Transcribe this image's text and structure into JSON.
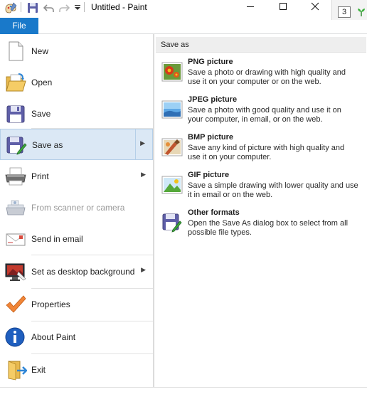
{
  "titlebar": {
    "title": "Untitled - Paint",
    "minimize_icon": "minimize-icon",
    "maximize_icon": "maximize-icon",
    "close_icon": "close-icon",
    "right_edge_value": "3"
  },
  "ribbon": {
    "file_tab": "File"
  },
  "menu": {
    "items": [
      {
        "label": "New",
        "icon": "new-document-icon"
      },
      {
        "label": "Open",
        "icon": "open-folder-icon"
      },
      {
        "label": "Save",
        "icon": "save-icon"
      },
      {
        "label": "Save as",
        "icon": "save-as-icon"
      },
      {
        "label": "Print",
        "icon": "printer-icon"
      },
      {
        "label": "From scanner or camera",
        "icon": "scanner-icon"
      },
      {
        "label": "Send in email",
        "icon": "email-icon"
      },
      {
        "label": "Set as desktop background",
        "icon": "desktop-background-icon"
      },
      {
        "label": "Properties",
        "icon": "checkmark-icon"
      },
      {
        "label": "About Paint",
        "icon": "info-icon"
      },
      {
        "label": "Exit",
        "icon": "exit-icon"
      }
    ]
  },
  "save_as": {
    "heading": "Save as",
    "options": [
      {
        "title": "PNG picture",
        "desc": "Save a photo or drawing with high quality and use it on your computer or on the web.",
        "icon": "png-picture-icon"
      },
      {
        "title": "JPEG picture",
        "desc": "Save a photo with good quality and use it on your computer, in email, or on the web.",
        "icon": "jpeg-picture-icon"
      },
      {
        "title": "BMP picture",
        "desc": "Save any kind of picture with high quality and use it on your computer.",
        "icon": "bmp-picture-icon"
      },
      {
        "title": "GIF picture",
        "desc": "Save a simple drawing with lower quality and use it in email or on the web.",
        "icon": "gif-picture-icon"
      },
      {
        "title": "Other formats",
        "desc": "Open the Save As dialog box to select from all possible file types.",
        "icon": "other-formats-icon"
      }
    ]
  },
  "colors": {
    "file_tab": "#1979ca",
    "selected_item": "#dbe8f5"
  }
}
